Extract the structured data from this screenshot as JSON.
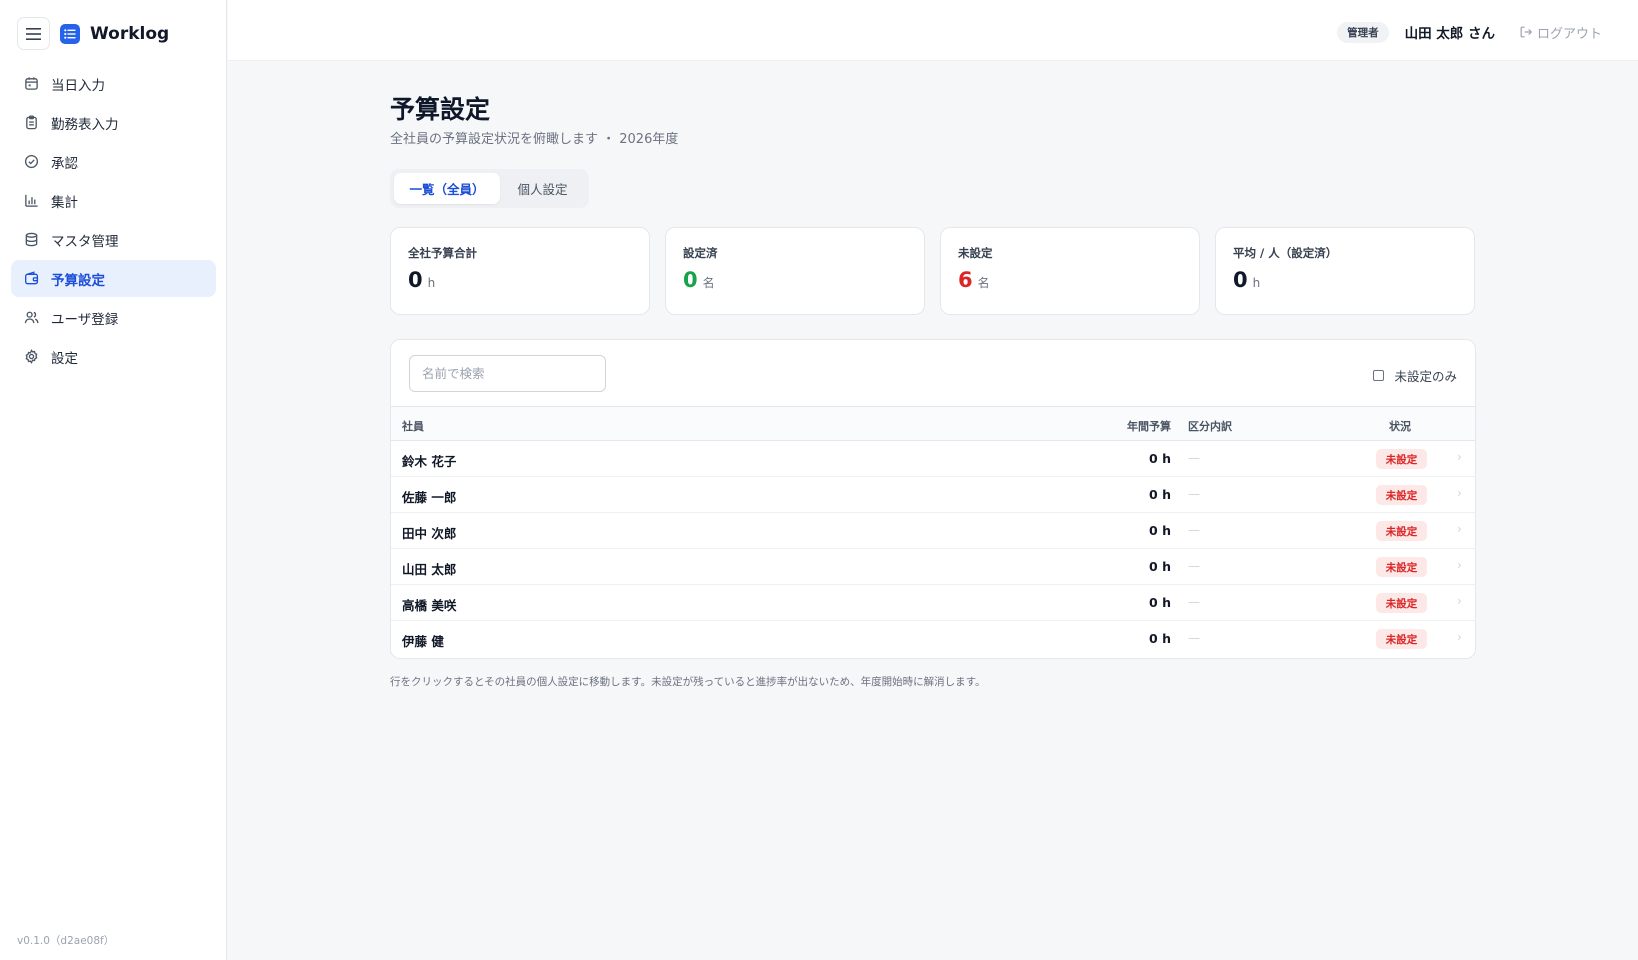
{
  "app": {
    "name": "Worklog",
    "version": "v0.1.0（d2ae08f）"
  },
  "sidebar": {
    "items": [
      {
        "label": "当日入力",
        "icon": "calendar-icon",
        "active": false
      },
      {
        "label": "勤務表入力",
        "icon": "clipboard-icon",
        "active": false
      },
      {
        "label": "承認",
        "icon": "check-circle-icon",
        "active": false
      },
      {
        "label": "集計",
        "icon": "bar-chart-icon",
        "active": false
      },
      {
        "label": "マスタ管理",
        "icon": "database-icon",
        "active": false
      },
      {
        "label": "予算設定",
        "icon": "wallet-icon",
        "active": true
      },
      {
        "label": "ユーザ登録",
        "icon": "users-icon",
        "active": false
      },
      {
        "label": "設定",
        "icon": "gear-icon",
        "active": false
      }
    ]
  },
  "header": {
    "role": "管理者",
    "user": "山田 太郎 さん",
    "logout": "ログアウト"
  },
  "page": {
    "title": "予算設定",
    "subtitle": "全社員の予算設定状況を俯瞰します ・ 2026年度"
  },
  "tabs": [
    {
      "label": "一覧（全員）",
      "active": true
    },
    {
      "label": "個人設定",
      "active": false
    }
  ],
  "stats": [
    {
      "label": "全社予算合計",
      "value": "0",
      "unit": "h"
    },
    {
      "label": "設定済",
      "value": "0",
      "unit": "名"
    },
    {
      "label": "未設定",
      "value": "6",
      "unit": "名"
    },
    {
      "label": "平均 / 人（設定済）",
      "value": "0",
      "unit": "h"
    }
  ],
  "table": {
    "search_placeholder": "名前で検索",
    "filter_label": "未設定のみ",
    "columns": [
      "社員",
      "年間予算",
      "区分内訳",
      "状況"
    ],
    "rows": [
      {
        "name": "鈴木 花子",
        "budget": "0 h",
        "breakdown": "—",
        "status": "未設定"
      },
      {
        "name": "佐藤 一郎",
        "budget": "0 h",
        "breakdown": "—",
        "status": "未設定"
      },
      {
        "name": "田中 次郎",
        "budget": "0 h",
        "breakdown": "—",
        "status": "未設定"
      },
      {
        "name": "山田 太郎",
        "budget": "0 h",
        "breakdown": "—",
        "status": "未設定"
      },
      {
        "name": "高橋 美咲",
        "budget": "0 h",
        "breakdown": "—",
        "status": "未設定"
      },
      {
        "name": "伊藤 健",
        "budget": "0 h",
        "breakdown": "—",
        "status": "未設定"
      }
    ]
  },
  "footnote": "行をクリックするとその社員の個人設定に移動します。未設定が残っていると進捗率が出ないため、年度開始時に解消します。",
  "colors": {
    "accent": "#2563eb",
    "active_bg": "#e8effd",
    "success": "#16a34a",
    "danger": "#dc2626",
    "status_bg": "#fde8e8"
  }
}
